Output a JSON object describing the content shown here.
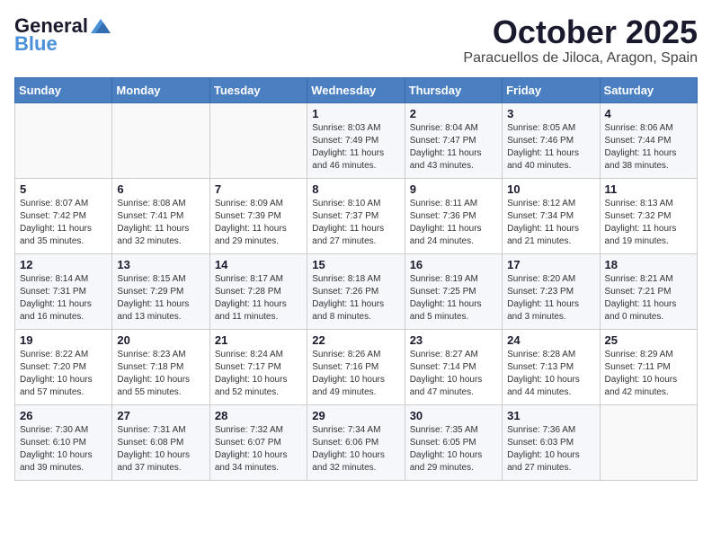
{
  "header": {
    "logo_general": "General",
    "logo_blue": "Blue",
    "month": "October 2025",
    "location": "Paracuellos de Jiloca, Aragon, Spain"
  },
  "weekdays": [
    "Sunday",
    "Monday",
    "Tuesday",
    "Wednesday",
    "Thursday",
    "Friday",
    "Saturday"
  ],
  "weeks": [
    [
      {
        "day": "",
        "sunrise": "",
        "sunset": "",
        "daylight": ""
      },
      {
        "day": "",
        "sunrise": "",
        "sunset": "",
        "daylight": ""
      },
      {
        "day": "",
        "sunrise": "",
        "sunset": "",
        "daylight": ""
      },
      {
        "day": "1",
        "sunrise": "Sunrise: 8:03 AM",
        "sunset": "Sunset: 7:49 PM",
        "daylight": "Daylight: 11 hours and 46 minutes."
      },
      {
        "day": "2",
        "sunrise": "Sunrise: 8:04 AM",
        "sunset": "Sunset: 7:47 PM",
        "daylight": "Daylight: 11 hours and 43 minutes."
      },
      {
        "day": "3",
        "sunrise": "Sunrise: 8:05 AM",
        "sunset": "Sunset: 7:46 PM",
        "daylight": "Daylight: 11 hours and 40 minutes."
      },
      {
        "day": "4",
        "sunrise": "Sunrise: 8:06 AM",
        "sunset": "Sunset: 7:44 PM",
        "daylight": "Daylight: 11 hours and 38 minutes."
      }
    ],
    [
      {
        "day": "5",
        "sunrise": "Sunrise: 8:07 AM",
        "sunset": "Sunset: 7:42 PM",
        "daylight": "Daylight: 11 hours and 35 minutes."
      },
      {
        "day": "6",
        "sunrise": "Sunrise: 8:08 AM",
        "sunset": "Sunset: 7:41 PM",
        "daylight": "Daylight: 11 hours and 32 minutes."
      },
      {
        "day": "7",
        "sunrise": "Sunrise: 8:09 AM",
        "sunset": "Sunset: 7:39 PM",
        "daylight": "Daylight: 11 hours and 29 minutes."
      },
      {
        "day": "8",
        "sunrise": "Sunrise: 8:10 AM",
        "sunset": "Sunset: 7:37 PM",
        "daylight": "Daylight: 11 hours and 27 minutes."
      },
      {
        "day": "9",
        "sunrise": "Sunrise: 8:11 AM",
        "sunset": "Sunset: 7:36 PM",
        "daylight": "Daylight: 11 hours and 24 minutes."
      },
      {
        "day": "10",
        "sunrise": "Sunrise: 8:12 AM",
        "sunset": "Sunset: 7:34 PM",
        "daylight": "Daylight: 11 hours and 21 minutes."
      },
      {
        "day": "11",
        "sunrise": "Sunrise: 8:13 AM",
        "sunset": "Sunset: 7:32 PM",
        "daylight": "Daylight: 11 hours and 19 minutes."
      }
    ],
    [
      {
        "day": "12",
        "sunrise": "Sunrise: 8:14 AM",
        "sunset": "Sunset: 7:31 PM",
        "daylight": "Daylight: 11 hours and 16 minutes."
      },
      {
        "day": "13",
        "sunrise": "Sunrise: 8:15 AM",
        "sunset": "Sunset: 7:29 PM",
        "daylight": "Daylight: 11 hours and 13 minutes."
      },
      {
        "day": "14",
        "sunrise": "Sunrise: 8:17 AM",
        "sunset": "Sunset: 7:28 PM",
        "daylight": "Daylight: 11 hours and 11 minutes."
      },
      {
        "day": "15",
        "sunrise": "Sunrise: 8:18 AM",
        "sunset": "Sunset: 7:26 PM",
        "daylight": "Daylight: 11 hours and 8 minutes."
      },
      {
        "day": "16",
        "sunrise": "Sunrise: 8:19 AM",
        "sunset": "Sunset: 7:25 PM",
        "daylight": "Daylight: 11 hours and 5 minutes."
      },
      {
        "day": "17",
        "sunrise": "Sunrise: 8:20 AM",
        "sunset": "Sunset: 7:23 PM",
        "daylight": "Daylight: 11 hours and 3 minutes."
      },
      {
        "day": "18",
        "sunrise": "Sunrise: 8:21 AM",
        "sunset": "Sunset: 7:21 PM",
        "daylight": "Daylight: 11 hours and 0 minutes."
      }
    ],
    [
      {
        "day": "19",
        "sunrise": "Sunrise: 8:22 AM",
        "sunset": "Sunset: 7:20 PM",
        "daylight": "Daylight: 10 hours and 57 minutes."
      },
      {
        "day": "20",
        "sunrise": "Sunrise: 8:23 AM",
        "sunset": "Sunset: 7:18 PM",
        "daylight": "Daylight: 10 hours and 55 minutes."
      },
      {
        "day": "21",
        "sunrise": "Sunrise: 8:24 AM",
        "sunset": "Sunset: 7:17 PM",
        "daylight": "Daylight: 10 hours and 52 minutes."
      },
      {
        "day": "22",
        "sunrise": "Sunrise: 8:26 AM",
        "sunset": "Sunset: 7:16 PM",
        "daylight": "Daylight: 10 hours and 49 minutes."
      },
      {
        "day": "23",
        "sunrise": "Sunrise: 8:27 AM",
        "sunset": "Sunset: 7:14 PM",
        "daylight": "Daylight: 10 hours and 47 minutes."
      },
      {
        "day": "24",
        "sunrise": "Sunrise: 8:28 AM",
        "sunset": "Sunset: 7:13 PM",
        "daylight": "Daylight: 10 hours and 44 minutes."
      },
      {
        "day": "25",
        "sunrise": "Sunrise: 8:29 AM",
        "sunset": "Sunset: 7:11 PM",
        "daylight": "Daylight: 10 hours and 42 minutes."
      }
    ],
    [
      {
        "day": "26",
        "sunrise": "Sunrise: 7:30 AM",
        "sunset": "Sunset: 6:10 PM",
        "daylight": "Daylight: 10 hours and 39 minutes."
      },
      {
        "day": "27",
        "sunrise": "Sunrise: 7:31 AM",
        "sunset": "Sunset: 6:08 PM",
        "daylight": "Daylight: 10 hours and 37 minutes."
      },
      {
        "day": "28",
        "sunrise": "Sunrise: 7:32 AM",
        "sunset": "Sunset: 6:07 PM",
        "daylight": "Daylight: 10 hours and 34 minutes."
      },
      {
        "day": "29",
        "sunrise": "Sunrise: 7:34 AM",
        "sunset": "Sunset: 6:06 PM",
        "daylight": "Daylight: 10 hours and 32 minutes."
      },
      {
        "day": "30",
        "sunrise": "Sunrise: 7:35 AM",
        "sunset": "Sunset: 6:05 PM",
        "daylight": "Daylight: 10 hours and 29 minutes."
      },
      {
        "day": "31",
        "sunrise": "Sunrise: 7:36 AM",
        "sunset": "Sunset: 6:03 PM",
        "daylight": "Daylight: 10 hours and 27 minutes."
      },
      {
        "day": "",
        "sunrise": "",
        "sunset": "",
        "daylight": ""
      }
    ]
  ]
}
